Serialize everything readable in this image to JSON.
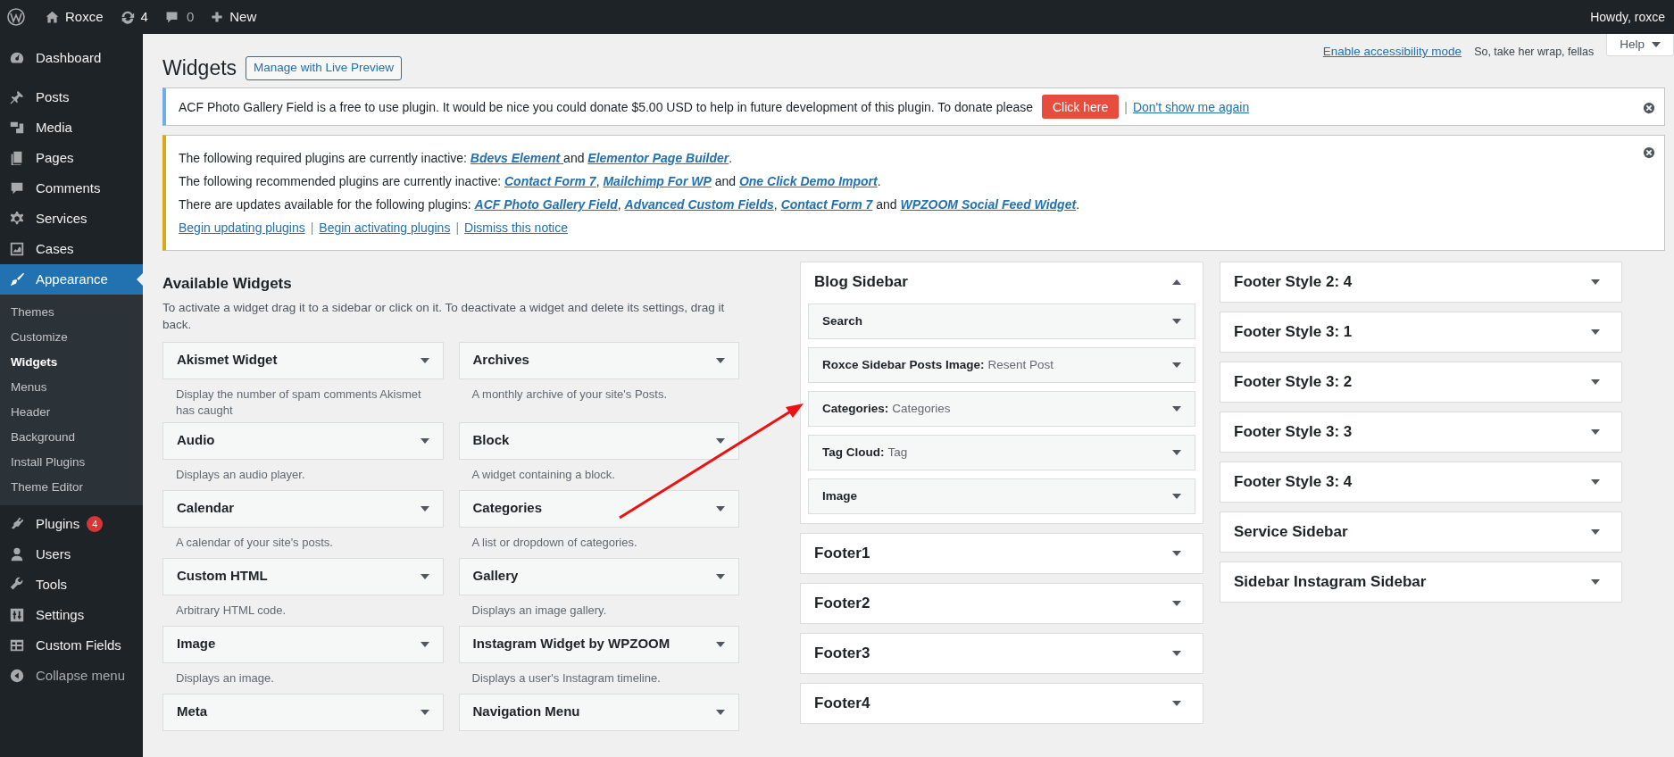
{
  "admin_bar": {
    "site": "Roxce",
    "updates": "4",
    "comments": "0",
    "new": "New",
    "greeting": "Howdy, roxce"
  },
  "menu": [
    {
      "label": "Dashboard",
      "selected": false
    },
    {
      "label": "Posts",
      "selected": false
    },
    {
      "label": "Media",
      "selected": false
    },
    {
      "label": "Pages",
      "selected": false
    },
    {
      "label": "Comments",
      "selected": false
    },
    {
      "label": "Services",
      "selected": false
    },
    {
      "label": "Cases",
      "selected": false
    },
    {
      "label": "Appearance",
      "selected": true,
      "children": [
        {
          "label": "Themes",
          "selected": false
        },
        {
          "label": "Customize",
          "selected": false
        },
        {
          "label": "Widgets",
          "selected": true
        },
        {
          "label": "Menus",
          "selected": false
        },
        {
          "label": "Header",
          "selected": false
        },
        {
          "label": "Background",
          "selected": false
        },
        {
          "label": "Install Plugins",
          "selected": false
        },
        {
          "label": "Theme Editor",
          "selected": false
        }
      ]
    },
    {
      "label": "Plugins",
      "selected": false,
      "badge": "4"
    },
    {
      "label": "Users",
      "selected": false
    },
    {
      "label": "Tools",
      "selected": false
    },
    {
      "label": "Settings",
      "selected": false
    },
    {
      "label": "Custom Fields",
      "selected": false
    },
    {
      "label": "Collapse menu",
      "kind": "collapse",
      "selected": false
    }
  ],
  "screen_meta": {
    "accessibility_link": "Enable accessibility mode",
    "tagline": "So, take her wrap, fellas",
    "help": "Help"
  },
  "page": {
    "title": "Widgets",
    "action": "Manage with Live Preview"
  },
  "notices": [
    {
      "kind": "info",
      "lines": [
        [
          {
            "text": "ACF Photo Gallery Field is a free to use plugin. It would be nice you could donate $5.00 USD to help in future development of this plugin. To donate please"
          },
          {
            "button": "Click here"
          },
          {
            "text": "|"
          },
          {
            "link": "Don't show me again"
          }
        ]
      ]
    },
    {
      "kind": "warning",
      "lines": [
        [
          {
            "text": "The following required plugins are currently inactive: "
          },
          {
            "link": "Bdevs Element "
          },
          {
            "text": "and "
          },
          {
            "link": "Elementor Page Builder"
          },
          {
            "text": "."
          }
        ],
        [
          {
            "text": "The following recommended plugins are currently inactive: "
          },
          {
            "link": "Contact Form 7"
          },
          {
            "text": ", "
          },
          {
            "link": "Mailchimp For WP"
          },
          {
            "text": " and "
          },
          {
            "link": "One Click Demo Import"
          },
          {
            "text": "."
          }
        ],
        [
          {
            "text": "There are updates available for the following plugins: "
          },
          {
            "link": "ACF Photo Gallery Field"
          },
          {
            "text": ", "
          },
          {
            "link": "Advanced Custom Fields"
          },
          {
            "text": ", "
          },
          {
            "link": "Contact Form 7"
          },
          {
            "text": " and "
          },
          {
            "link": "WPZOOM Social Feed Widget"
          },
          {
            "text": "."
          }
        ],
        [
          {
            "plainlink": "Begin updating plugins"
          },
          {
            "text": "|"
          },
          {
            "plainlink": "Begin activating plugins"
          },
          {
            "text": "|"
          },
          {
            "plainlink": "Dismiss this notice"
          }
        ]
      ]
    }
  ],
  "available_widgets": {
    "title": "Available Widgets",
    "description": "To activate a widget drag it to a sidebar or click on it. To deactivate a widget and delete its settings, drag it back.",
    "widgets": [
      {
        "name": "Akismet Widget",
        "description": "Display the number of spam comments Akismet has caught"
      },
      {
        "name": "Archives",
        "description": "A monthly archive of your site's Posts."
      },
      {
        "name": "Audio",
        "description": "Displays an audio player."
      },
      {
        "name": "Block",
        "description": "A widget containing a block."
      },
      {
        "name": "Calendar",
        "description": "A calendar of your site's posts."
      },
      {
        "name": "Categories",
        "description": "A list or dropdown of categories."
      },
      {
        "name": "Custom HTML",
        "description": "Arbitrary HTML code."
      },
      {
        "name": "Gallery",
        "description": "Displays an image gallery."
      },
      {
        "name": "Image",
        "description": "Displays an image."
      },
      {
        "name": "Instagram Widget by WPZOOM",
        "description": "Displays a user's Instagram timeline."
      },
      {
        "name": "Meta"
      },
      {
        "name": "Navigation Menu"
      }
    ]
  },
  "sidebars_column_1": [
    {
      "title": "Blog Sidebar",
      "expanded": true,
      "widgets": [
        {
          "name": "Search"
        },
        {
          "name": "Roxce Sidebar Posts Image:",
          "subtitle": "Resent Post"
        },
        {
          "name": "Categories:",
          "subtitle": "Categories"
        },
        {
          "name": "Tag Cloud:",
          "subtitle": "Tag"
        },
        {
          "name": "Image"
        }
      ]
    },
    {
      "title": "Footer1",
      "expanded": false
    },
    {
      "title": "Footer2",
      "expanded": false
    },
    {
      "title": "Footer3",
      "expanded": false
    },
    {
      "title": "Footer4",
      "expanded": false
    }
  ],
  "sidebars_column_2": [
    {
      "title": "Footer Style 2: 4",
      "expanded": false
    },
    {
      "title": "Footer Style 3: 1",
      "expanded": false
    },
    {
      "title": "Footer Style 3: 2",
      "expanded": false
    },
    {
      "title": "Footer Style 3: 3",
      "expanded": false
    },
    {
      "title": "Footer Style 3: 4",
      "expanded": false
    },
    {
      "title": "Service Sidebar",
      "expanded": false
    },
    {
      "title": "Sidebar Instagram Sidebar",
      "expanded": false
    }
  ]
}
